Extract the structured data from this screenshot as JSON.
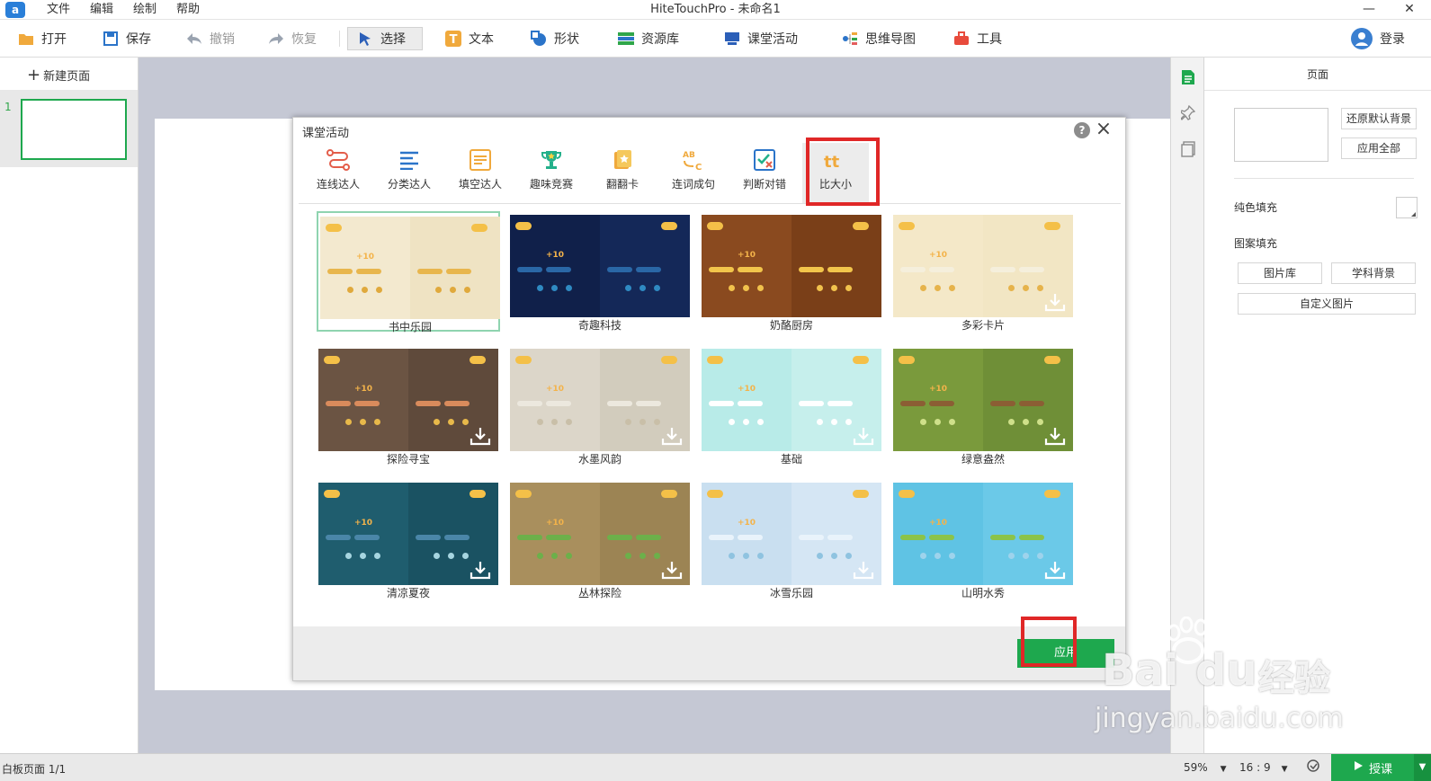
{
  "window": {
    "title": "HiteTouchPro - 未命名1",
    "menu": [
      "文件",
      "编辑",
      "绘制",
      "帮助"
    ]
  },
  "toolbar": {
    "open": "打开",
    "save": "保存",
    "undo": "撤销",
    "redo": "恢复",
    "select": "选择",
    "text": "文本",
    "shape": "形状",
    "resources": "资源库",
    "classroom": "课堂活动",
    "mindmap": "思维导图",
    "tools": "工具",
    "login": "登录"
  },
  "pages": {
    "new_page": "新建页面",
    "items": [
      {
        "number": "1"
      }
    ]
  },
  "dialog": {
    "title": "课堂活动",
    "tabs": [
      {
        "label": "连线达人",
        "icon": "connect-icon"
      },
      {
        "label": "分类达人",
        "icon": "classify-icon"
      },
      {
        "label": "填空达人",
        "icon": "fill-blank-icon"
      },
      {
        "label": "趣味竞赛",
        "icon": "trophy-icon"
      },
      {
        "label": "翻翻卡",
        "icon": "flip-card-icon"
      },
      {
        "label": "连词成句",
        "icon": "word-sentence-icon"
      },
      {
        "label": "判断对错",
        "icon": "true-false-icon"
      },
      {
        "label": "比大小",
        "icon": "compare-size-icon",
        "active": true
      }
    ],
    "themes": [
      {
        "name": "书中乐园",
        "bg": "#f3e9cf",
        "bg2": "#efe3c3",
        "bar": "#e8b64d",
        "dot": "#e0a93c",
        "download": false,
        "selected": true
      },
      {
        "name": "奇趣科技",
        "bg": "#10204a",
        "bg2": "#142858",
        "bar": "#2a67a6",
        "dot": "#2f8ac2",
        "download": false,
        "selected": false
      },
      {
        "name": "奶酪厨房",
        "bg": "#8a4a1f",
        "bg2": "#7a3f18",
        "bar": "#f2c54b",
        "dot": "#f1c24c",
        "download": false,
        "selected": false
      },
      {
        "name": "多彩卡片",
        "bg": "#f4e8c8",
        "bg2": "#f2e6c4",
        "bar": "#f5efdc",
        "dot": "#e6b34b",
        "download": true,
        "selected": false
      },
      {
        "name": "探险寻宝",
        "bg": "#6b5443",
        "bg2": "#5f4a3b",
        "bar": "#d98b5c",
        "dot": "#e8b94a",
        "download": true,
        "selected": false
      },
      {
        "name": "水墨风韵",
        "bg": "#dcd6c9",
        "bg2": "#d2ccbd",
        "bar": "#ece8de",
        "dot": "#c9bfa8",
        "download": true,
        "selected": false
      },
      {
        "name": "基础",
        "bg": "#b8ebe8",
        "bg2": "#c6efec",
        "bar": "#ffffff",
        "dot": "#ffffff",
        "download": true,
        "selected": false
      },
      {
        "name": "绿意盎然",
        "bg": "#7a9a3c",
        "bg2": "#6f8f37",
        "bar": "#8b5e34",
        "dot": "#cfe08a",
        "download": true,
        "selected": false
      },
      {
        "name": "清凉夏夜",
        "bg": "#1f5d6e",
        "bg2": "#1a5262",
        "bar": "#4a86a8",
        "dot": "#a6d5e0",
        "download": true,
        "selected": false
      },
      {
        "name": "丛林探险",
        "bg": "#a98f5d",
        "bg2": "#9c8454",
        "bar": "#6cb04a",
        "dot": "#6cb04a",
        "download": true,
        "selected": false
      },
      {
        "name": "冰雪乐园",
        "bg": "#c9dff0",
        "bg2": "#d5e6f4",
        "bar": "#e9f3fb",
        "dot": "#8fc3e0",
        "download": true,
        "selected": false
      },
      {
        "name": "山明水秀",
        "bg": "#5fc3e4",
        "bg2": "#6bc9e8",
        "bar": "#8bc34a",
        "dot": "#9ed3ec",
        "download": true,
        "selected": false
      }
    ],
    "apply": "应用"
  },
  "right_panel": {
    "title": "页面",
    "restore_bg": "还原默认背景",
    "apply_all": "应用全部",
    "solid_fill": "纯色填充",
    "pattern_fill": "图案填充",
    "gallery": "图片库",
    "subject_bg": "学科背景",
    "custom_image": "自定义图片"
  },
  "status": {
    "page_info": "白板页面 1/1",
    "zoom": "59%",
    "ratio": "16 : 9",
    "teach": "授课"
  },
  "colors": {
    "accent_green": "#1ea84e",
    "highlight_red": "#e02727",
    "canvas_bg": "#c5c8d4"
  },
  "watermark": {
    "brand": "Bai",
    "brand_tail": "du",
    "cn": "经验",
    "url": "jingyan.baidu.com"
  }
}
